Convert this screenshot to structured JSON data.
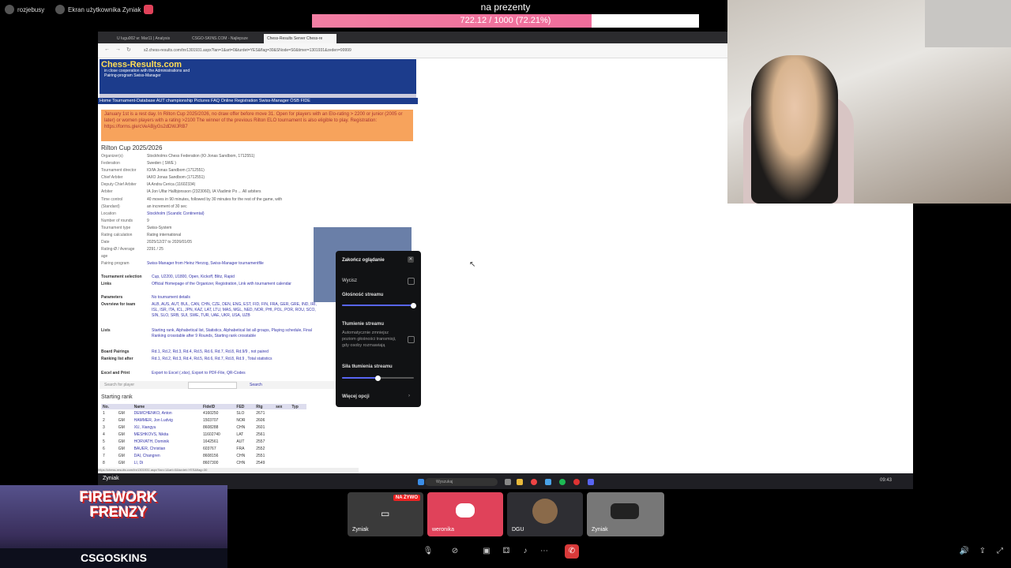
{
  "stream": {
    "top_items": [
      {
        "label": "rozjebusy"
      },
      {
        "label": "Ekran użytkownika Zyniak"
      }
    ],
    "goal": {
      "title": "na prezenty",
      "progress_text": "722.12 / 1000 (72.21%)",
      "fraction": 0.7221
    },
    "owner_label": "Zyniak"
  },
  "browser": {
    "tabs": [
      {
        "label": "U Iugu002 w: Mar11 | Analysis"
      },
      {
        "label": "CSGO-SKINS.COM - Najlepsze"
      },
      {
        "label": "Chess-Results Server Chess-re"
      }
    ],
    "url": "s2.chess-results.com/tnr1301931.aspx?lan=1&art=0&turdet=YES&flag=30&SNode=S0&timer=1301931&zeden=99999",
    "status_url": "https://chess-results.com/tnr1301931.aspx?lan=1&art=0&turdet=YES&flag=30"
  },
  "page": {
    "site_title": "Chess-Results.com",
    "site_sub": "in close cooperation with the Administrations and Pairing-program Swiss-Manager",
    "nav": "Home  Tournament-Database  AUT championship  Pictures  FAQ  Online Registration  Swiss-Manager  ÖSB  FIDE",
    "notice": "January 1st is a rest day. In Rilton Cup 2025/2026, no draw offer before move 31. Open for players with an Elo-rating > 2200 or junior (2005 or later) or women players with a rating >2100 The winner of the previous Rilton ELO tournament is also eligible to play. Registration: https://forms.gle/cVeABjyGs2dDWJRB7",
    "title": "Rilton Cup 2025/2026",
    "info": [
      {
        "k": "Organizer(s)",
        "v": "Stockholms Chess Federation (IO Jonas Sandbom, 1712551)"
      },
      {
        "k": "Federation",
        "v": "Sweden ( SWE )"
      },
      {
        "k": "Tournament director",
        "v": "IO/IA Jonas Sandbom (1712551)"
      },
      {
        "k": "Chief Arbiter",
        "v": "IA/IO Jonas Sandbom (1712551)"
      },
      {
        "k": "Deputy Chief Arbiter",
        "v": "IA Andra Cerica (11602334)"
      },
      {
        "k": "Arbiter",
        "v": "IA Jon Ulfar Hallbjonsson (2323060), IA Vladimir Po ...  All arbiters"
      },
      {
        "k": "Time control",
        "v": "40 moves in 90 minutes, followed by 30 minutes for the rest of the game, with"
      },
      {
        "k": "(Standard)",
        "v": "an increment of 30 sec"
      },
      {
        "k": "Location",
        "v": "Stockholm (Scandic Continental)"
      },
      {
        "k": "Number of rounds",
        "v": "9"
      },
      {
        "k": "Tournament type",
        "v": "Swiss-System"
      },
      {
        "k": "Rating calculation",
        "v": "Rating international"
      },
      {
        "k": "Date",
        "v": "2025/12/27 to 2026/01/05"
      },
      {
        "k": "Rating-Ø / Average",
        "v": "2291 / 25"
      },
      {
        "k": "age",
        "v": ""
      },
      {
        "k": "Pairing program",
        "v": "Swiss-Manager from Heinz Herzog, Swiss-Manager tournamentfile"
      }
    ],
    "sections": [
      {
        "k": "Tournament selection",
        "v": "Cup, U2200, U1800, Open, Kickoff, Blitz, Rapid"
      },
      {
        "k": "Links",
        "v": "Official Homepage of the Organizer, Registration, Link with tournament calendar"
      },
      {
        "k": "Parameters",
        "v": "No tournament details"
      },
      {
        "k": "Overview for team",
        "v": "ALB, AUS, AUT, BUL, CAN, CHN, CZE, DEN, ENG, EST, FID, FIN, FRA, GER, GRE, IND, IRI, ISL, ISR, ITA, ICL, JPN, KAZ, LAT, LTU, MAS, MGL, NED, NOR, PHI, POL, POR, ROU, SCO, SIN, SLO, SRB, SUI, SWE, TUR, UAE, UKR, USA, UZB"
      },
      {
        "k": "Lists",
        "v": "Starting rank, Alphabetical list, Statistics, Alphabetical list all groups, Playing schedule, Final Ranking crosstable after 9 Rounds, Starting rank crosstable"
      },
      {
        "k": "Board Pairings",
        "v": "Rd.1, Rd.2, Rd.3, Rd.4, Rd.5, Rd.6, Rd.7, Rd.8, Rd.9/9 , not paired"
      },
      {
        "k": "Ranking list after",
        "v": "Rd.1, Rd.2, Rd.3, Rd.4, Rd.5, Rd.6, Rd.7, Rd.8, Rd.9 , Total statistics"
      },
      {
        "k": "Excel and Print",
        "v": "Export to Excel (.xlsx), Export to PDF-File, QR-Codes"
      }
    ],
    "search_placeholder": "Search for player",
    "search_button": "Search",
    "starting_rank_title": "Starting rank",
    "table_headers": [
      "No.",
      "",
      "Name",
      "FideID",
      "FED",
      "Rtg",
      "sex",
      "Typ"
    ],
    "rows": [
      [
        "1",
        "GM",
        "DEMCHENKO, Anton",
        "4160250",
        "SLO",
        "2671"
      ],
      [
        "2",
        "GM",
        "HAMMER, Jon Ludvig",
        "1503707",
        "NOR",
        "2606"
      ],
      [
        "3",
        "GM",
        "XU, Xiangyu",
        "8608288",
        "CHN",
        "2601"
      ],
      [
        "4",
        "GM",
        "MESHKOVS, Nikita",
        "11602740",
        "LAT",
        "2561"
      ],
      [
        "5",
        "GM",
        "HORVATH, Dominik",
        "1642561",
        "AUT",
        "2557"
      ],
      [
        "6",
        "GM",
        "BAUER, Christian",
        "603767",
        "FRA",
        "2552"
      ],
      [
        "7",
        "GM",
        "DAI, Changren",
        "8608156",
        "CHN",
        "2551"
      ],
      [
        "8",
        "GM",
        "LI, Di",
        "8607300",
        "CHN",
        "2549"
      ]
    ]
  },
  "popup": {
    "title": "Zakończ oglądanie",
    "mute": "Wycisz",
    "volume_label": "Głośność streamu",
    "volume": 1.0,
    "dampen_label": "Tłumienie streamu",
    "dampen_desc": "Automatycznie zmniejsz poziom głośności transmisji, gdy osoby rozmawiają",
    "dampen_strength_label": "Siła tłumienia streamu",
    "dampen_strength": 0.5,
    "more": "Więcej opcji"
  },
  "taskbar": {
    "search": "Wyszukaj",
    "time": "09:43"
  },
  "game_ad": {
    "title_line1": "FIREWORK",
    "title_line2": "FRENZY",
    "footer": "CSGOSKINS"
  },
  "participants": [
    {
      "name": "Zyniak",
      "live": "NA ŻYWO"
    },
    {
      "name": "weronika"
    },
    {
      "name": "DGU"
    },
    {
      "name": "Zyniak"
    }
  ],
  "colors": {
    "goal_fill": "#f06d9b",
    "discord": "#e0425a",
    "header_blue": "#1c3c8c",
    "notice": "#f7a35c"
  }
}
